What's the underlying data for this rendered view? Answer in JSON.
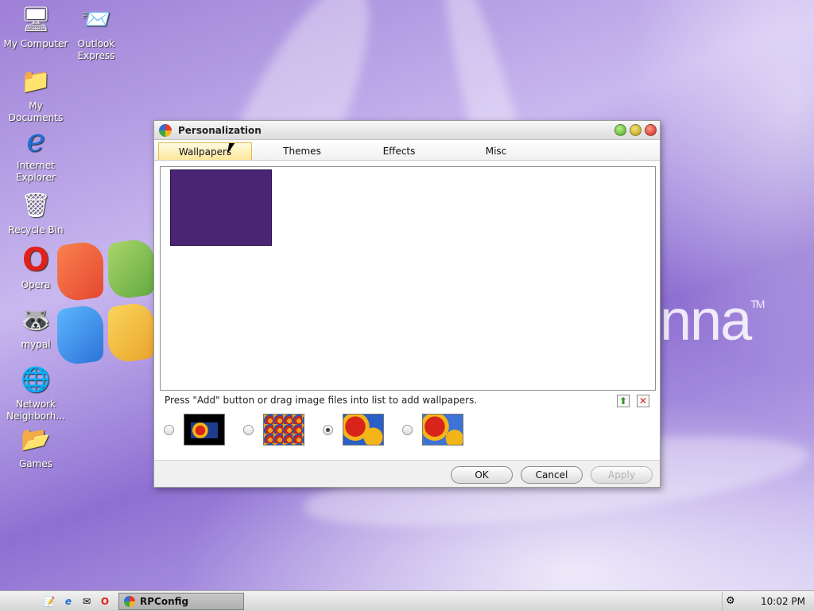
{
  "desktop": {
    "icons": [
      {
        "label": "My Computer",
        "glyph": "🖥"
      },
      {
        "label": "Outlook Express",
        "glyph": "📨"
      },
      {
        "label": "My Documents",
        "glyph": "📁"
      },
      {
        "label": "Internet Explorer",
        "glyph": "e"
      },
      {
        "label": "Recycle Bin",
        "glyph": "🗑"
      },
      {
        "label": "Opera",
        "glyph": "O"
      },
      {
        "label": "mypal",
        "glyph": "🦝"
      },
      {
        "label": "Network Neighborh...",
        "glyph": "🌐"
      },
      {
        "label": "Games",
        "glyph": "📂"
      }
    ],
    "brand_text": "nna",
    "brand_mark": "TM"
  },
  "window": {
    "title": "Personalization",
    "tabs": [
      "Wallpapers",
      "Themes",
      "Effects",
      "Misc"
    ],
    "active_tab": "Wallpapers",
    "preview_color": "#4a2573",
    "hint": "Press \"Add\" button or drag image files into list to add wallpapers.",
    "add_glyph": "⬆",
    "remove_glyph": "✕",
    "selected_thumbnail": 3,
    "buttons": {
      "ok": "OK",
      "cancel": "Cancel",
      "apply": "Apply"
    }
  },
  "taskbar": {
    "start_glyph": "",
    "task_label": "RPConfig",
    "clock": "10:02 PM"
  }
}
